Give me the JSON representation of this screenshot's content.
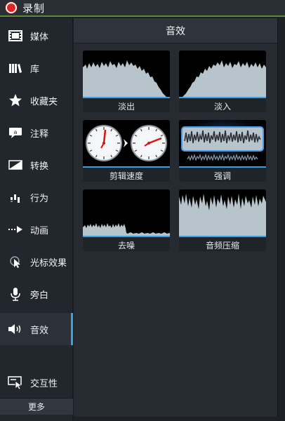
{
  "topbar": {
    "title": "录制"
  },
  "sidebar": {
    "items": [
      {
        "label": "媒体",
        "icon": "film-strip-icon"
      },
      {
        "label": "库",
        "icon": "books-icon"
      },
      {
        "label": "收藏夹",
        "icon": "star-icon"
      },
      {
        "label": "注释",
        "icon": "annotation-icon"
      },
      {
        "label": "转换",
        "icon": "transition-icon"
      },
      {
        "label": "行为",
        "icon": "behavior-icon"
      },
      {
        "label": "动画",
        "icon": "animation-arrow-icon"
      },
      {
        "label": "光标效果",
        "icon": "cursor-effect-icon"
      },
      {
        "label": "旁白",
        "icon": "microphone-icon"
      },
      {
        "label": "音效",
        "icon": "speaker-icon"
      },
      {
        "label": "交互性",
        "icon": "interactivity-icon"
      }
    ],
    "active": "音效",
    "more_label": "更多"
  },
  "panel": {
    "title": "音效",
    "tiles": [
      {
        "label": "淡出",
        "thumb": "fade-out-waveform"
      },
      {
        "label": "淡入",
        "thumb": "fade-in-waveform"
      },
      {
        "label": "剪辑速度",
        "thumb": "clip-speed-clocks"
      },
      {
        "label": "强调",
        "thumb": "emphasize-waveform"
      },
      {
        "label": "去噪",
        "thumb": "noise-removal-waveform"
      },
      {
        "label": "音频压缩",
        "thumb": "audio-compression-waveform"
      }
    ]
  },
  "colors": {
    "accent": "#3aa0e6",
    "record": "#e02424",
    "waveform": "#b8c4cc",
    "background": "#1b1f24"
  }
}
